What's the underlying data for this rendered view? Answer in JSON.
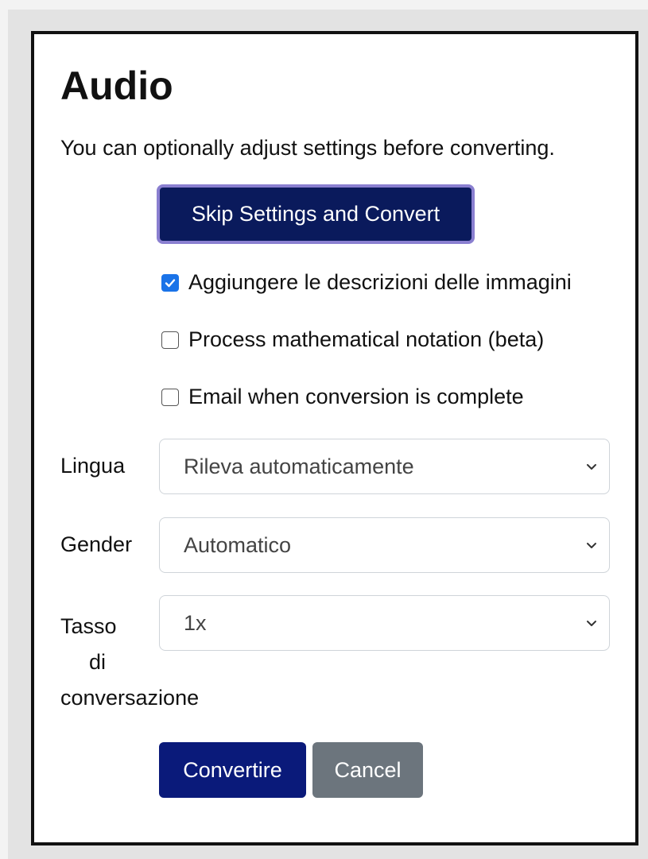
{
  "dialog": {
    "title": "Audio",
    "subtitle": "You can optionally adjust settings before converting.",
    "skip_button": "Skip Settings and Convert"
  },
  "options": [
    {
      "label": "Aggiungere le descrizioni delle immagini",
      "checked": true
    },
    {
      "label": "Process mathematical notation (beta)",
      "checked": false
    },
    {
      "label": "Email when conversion is complete",
      "checked": false
    }
  ],
  "fields": {
    "language": {
      "label": "Lingua",
      "value": "Rileva automaticamente"
    },
    "gender": {
      "label": "Gender",
      "value": "Automatico"
    },
    "rate": {
      "label_lines": [
        "Tasso",
        "di",
        "conversazione"
      ],
      "value": "1x"
    }
  },
  "actions": {
    "convert": "Convertire",
    "cancel": "Cancel"
  },
  "colors": {
    "primary": "#0a1a7a",
    "skip_button_bg": "#0a1a5c",
    "skip_button_focus_ring": "#8a7fd0",
    "secondary": "#6c757d",
    "checkbox_checked": "#1a73e8"
  }
}
